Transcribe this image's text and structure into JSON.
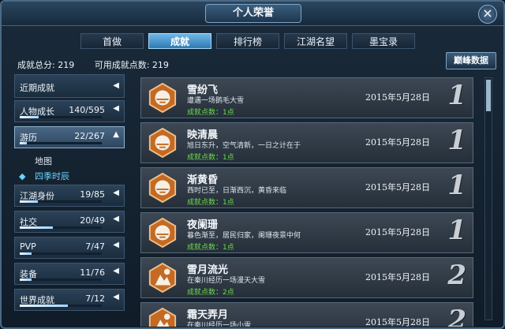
{
  "window": {
    "title": "个人荣誉",
    "close": "×"
  },
  "tabs": [
    {
      "label": "首做"
    },
    {
      "label": "成就"
    },
    {
      "label": "排行榜"
    },
    {
      "label": "江湖名望"
    },
    {
      "label": "墨宝录"
    }
  ],
  "active_tab": "成就",
  "totals": {
    "score_label": "成就总分: 219",
    "points_label": "可用成就点数: 219"
  },
  "peak_button": "巅峰数据",
  "sidebar": {
    "items": [
      {
        "label": "近期成就",
        "count": "",
        "progress": null,
        "arrow": "◀"
      },
      {
        "label": "人物成长",
        "count": "140/595",
        "progress": 0.235,
        "arrow": "◀"
      },
      {
        "label": "游历",
        "count": "22/267",
        "progress": 0.082,
        "arrow": "▲"
      },
      {
        "label": "江湖身份",
        "count": "19/85",
        "progress": 0.224,
        "arrow": "◀"
      },
      {
        "label": "社交",
        "count": "20/49",
        "progress": 0.408,
        "arrow": "◀"
      },
      {
        "label": "PVP",
        "count": "7/47",
        "progress": 0.149,
        "arrow": "◀"
      },
      {
        "label": "装备",
        "count": "11/76",
        "progress": 0.145,
        "arrow": "◀"
      },
      {
        "label": "世界成就",
        "count": "7/12",
        "progress": 0.583,
        "arrow": "◀"
      }
    ],
    "subitems": [
      {
        "label": "地图"
      },
      {
        "label": "四季时辰",
        "marker": "◆"
      }
    ]
  },
  "achievements": [
    {
      "name": "雪纷飞",
      "desc": "遭遇一场鹅毛大雪",
      "points": "成就点数：1点",
      "date": "2015年5月28日",
      "tier": "1",
      "icon": "snow-weather-icon"
    },
    {
      "name": "映清晨",
      "desc": "旭日东升，空气清新，一日之计在于",
      "points": "成就点数：1点",
      "date": "2015年5月28日",
      "tier": "1",
      "icon": "sunrise-weather-icon"
    },
    {
      "name": "渐黄昏",
      "desc": "西时已至，日渐西沉，黄昏来临",
      "points": "成就点数：1点",
      "date": "2015年5月28日",
      "tier": "1",
      "icon": "dusk-weather-icon"
    },
    {
      "name": "夜阑珊",
      "desc": "暮色渐至，居民归家，阑珊夜景中何",
      "points": "成就点数：1点",
      "date": "2015年5月28日",
      "tier": "1",
      "icon": "night-weather-icon"
    },
    {
      "name": "雪月流光",
      "desc": "在秦川经历一场漫天大雪",
      "points": "成就点数：2点",
      "date": "2015年5月28日",
      "tier": "2",
      "icon": "snow-moon-icon"
    },
    {
      "name": "霜天弄月",
      "desc": "在秦川经历一场小雪",
      "points": "",
      "date": "2015年5月28日",
      "tier": "2",
      "icon": "frost-moon-icon"
    }
  ],
  "colors": {
    "accent": "#6fb7e6",
    "points_green": "#6bdc4a",
    "badge_orange": "#c46a24"
  }
}
